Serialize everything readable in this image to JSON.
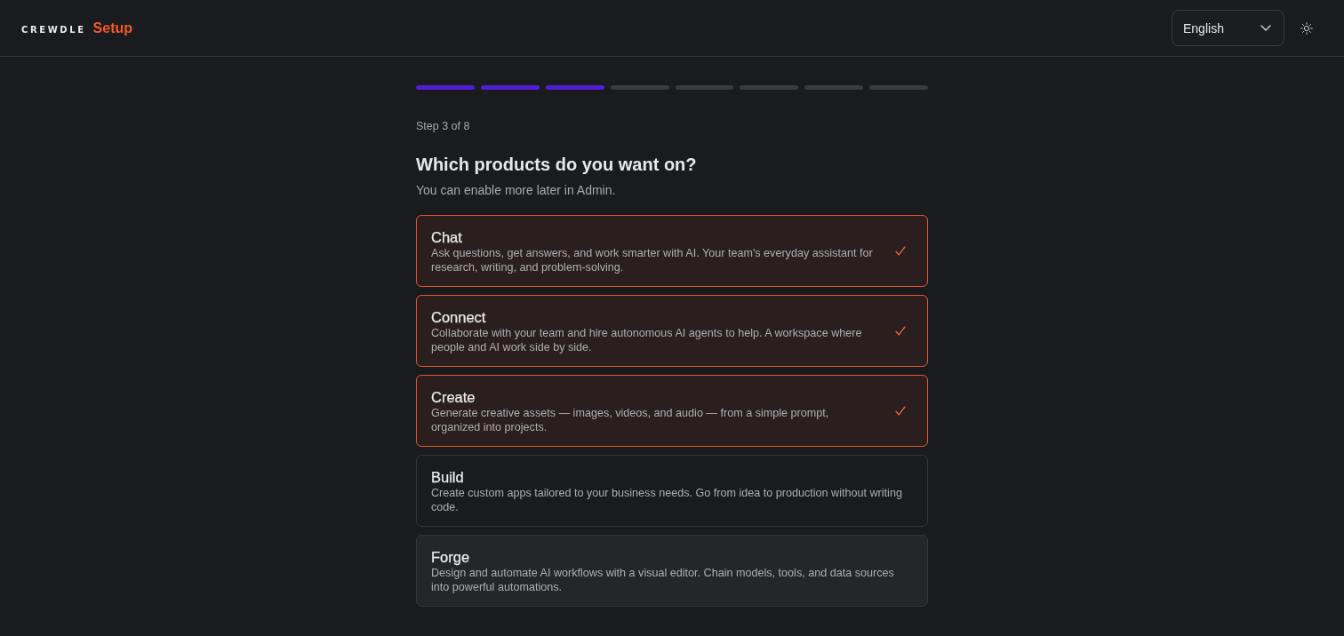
{
  "header": {
    "logo": "CREWDLE",
    "title": "Setup",
    "language": {
      "value": "English"
    }
  },
  "progress": [
    {
      "done": true
    },
    {
      "done": true
    },
    {
      "done": true
    },
    {
      "done": false
    },
    {
      "done": false
    },
    {
      "done": false
    },
    {
      "done": false
    },
    {
      "done": false
    }
  ],
  "step_label": "Step 3 of 8",
  "heading": "Which products do you want on?",
  "subheading": "You can enable more later in Admin.",
  "products": [
    {
      "name": "Chat",
      "description": "Ask questions, get answers, and work smarter with AI. Your team's everyday assistant for research, writing, and problem-solving.",
      "selected": true,
      "hovered": false
    },
    {
      "name": "Connect",
      "description": "Collaborate with your team and hire autonomous AI agents to help. A workspace where people and AI work side by side.",
      "selected": true,
      "hovered": false
    },
    {
      "name": "Create",
      "description": "Generate creative assets — images, videos, and audio — from a simple prompt, organized into projects.",
      "selected": true,
      "hovered": false
    },
    {
      "name": "Build",
      "description": "Create custom apps tailored to your business needs. Go from idea to production without writing code.",
      "selected": false,
      "hovered": false
    },
    {
      "name": "Forge",
      "description": "Design and automate AI workflows with a visual editor. Chain models, tools, and data sources into powerful automations.",
      "selected": false,
      "hovered": true
    }
  ]
}
